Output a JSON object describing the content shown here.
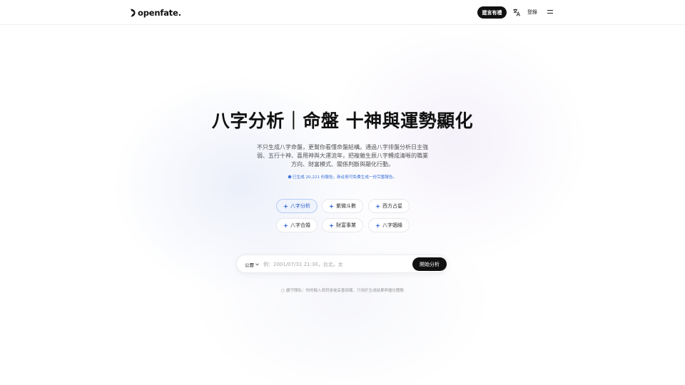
{
  "header": {
    "logo_text": "openfate.",
    "hope_button": "建言有禮",
    "login": "登錄"
  },
  "hero": {
    "title": "八字分析｜命盤 十神與運勢顯化",
    "description": "不只生成八字命盤，更幫你看懂命盤結構。通過八字排盤分析日主強弱、五行十神、喜用神與大運流年，把複雜生辰八字轉成清晰的職業方向、財富模式、關係判斷與顯化行動。",
    "stat": "已生成 20,221 份報告。新註冊可免費生成一份完整報告。"
  },
  "chips": [
    {
      "label": "八字分析",
      "active": true
    },
    {
      "label": "紫微斗數",
      "active": false
    },
    {
      "label": "西方占星",
      "active": false
    },
    {
      "label": "八字合婚",
      "active": false
    },
    {
      "label": "財富事業",
      "active": false
    },
    {
      "label": "八字姻緣",
      "active": false
    }
  ],
  "search": {
    "calendar": "公曆",
    "placeholder": "例：2001/07/31 21:30，台北，女",
    "value": "",
    "button": "開始分析"
  },
  "privacy": "嚴守隱私：你的輸入資訊會被妥善保護，只用於生成結果與優化體驗",
  "colors": {
    "accent": "#3a6fd8",
    "dark": "#111111"
  }
}
